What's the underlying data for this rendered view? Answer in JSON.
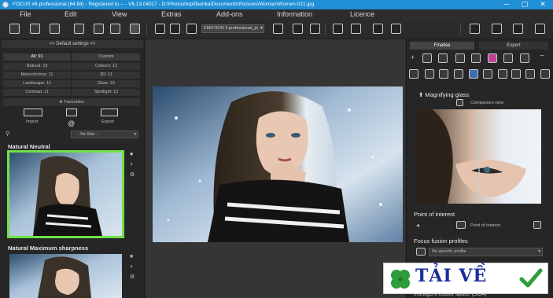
{
  "window": {
    "title": "FOCUS #6 professional (64 bit) - Registered to -- - V6.13.04017 - D:\\Photoshop\\flashka\\Documents\\Pictures\\Woman\\Women-021.jpg",
    "controls": [
      "─",
      "▢",
      "✕"
    ]
  },
  "menu": {
    "items": [
      "File",
      "Edit",
      "View",
      "Extras",
      "Add-ons",
      "Information",
      "Licence"
    ]
  },
  "toolbar": {
    "preset": "EMOTION 3 professional_pr"
  },
  "left_panel": {
    "header": ">> Default settings <<",
    "summary": [
      {
        "label": "All: 91",
        "hl": true
      },
      {
        "label": "Custom",
        "hl": false
      }
    ],
    "categories": [
      [
        "Natural: 15",
        "Colours: 12"
      ],
      [
        "Monochrome: 11",
        "3D: 11"
      ],
      [
        "Landscape: 11",
        "Glow: 10"
      ],
      [
        "Contrast: 11",
        "Spotlight: 12"
      ]
    ],
    "favourites": "Favourites",
    "import_label": "Import",
    "export_label": "Export",
    "filter": "-- No filter --",
    "presets": [
      {
        "title": "Natural Neutral"
      },
      {
        "title": "Natural Maximum sharpness"
      }
    ]
  },
  "right_panel": {
    "tabs": [
      "Finalise",
      "Expert"
    ],
    "active_tab": "Finalise",
    "magnifier_title": "Magnifying glass",
    "comparison_label": "Comparison view",
    "poi_title": "Point of interest",
    "poi_button": "Point of interest",
    "fusion_title": "Focus fusion profiles",
    "fusion_select": "No specific profile",
    "bottom_text": "Intelligent colour space (SCA)"
  },
  "watermark": {
    "text": "TẢI VỀ",
    "icons": [
      "clover-icon",
      "checkmark-icon"
    ]
  },
  "colors": {
    "titlebar": "#1f8fd6",
    "selection": "#6ee24a",
    "watermark_text": "#1a2e9b"
  }
}
